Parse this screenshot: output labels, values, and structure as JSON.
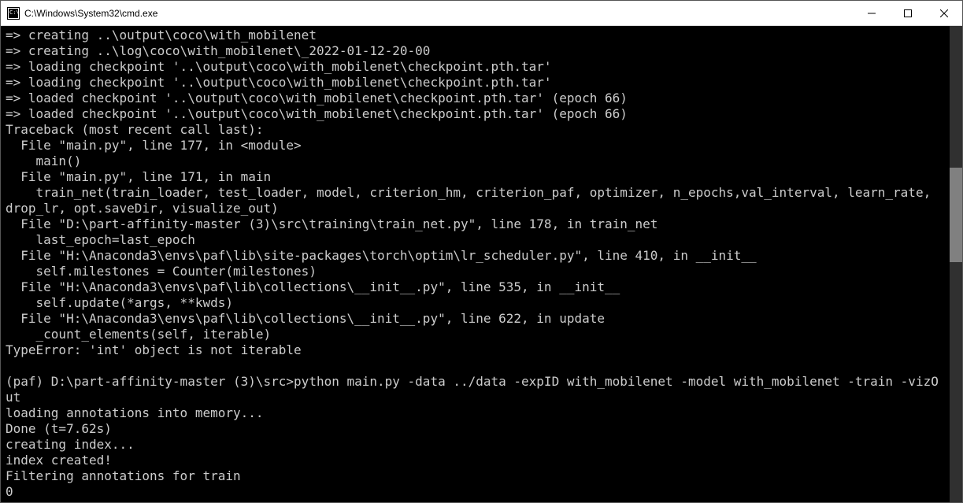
{
  "window": {
    "title": "C:\\Windows\\System32\\cmd.exe"
  },
  "terminal": {
    "lines": [
      "=> creating ..\\output\\coco\\with_mobilenet",
      "=> creating ..\\log\\coco\\with_mobilenet\\_2022-01-12-20-00",
      "=> loading checkpoint '..\\output\\coco\\with_mobilenet\\checkpoint.pth.tar'",
      "=> loading checkpoint '..\\output\\coco\\with_mobilenet\\checkpoint.pth.tar'",
      "=> loaded checkpoint '..\\output\\coco\\with_mobilenet\\checkpoint.pth.tar' (epoch 66)",
      "=> loaded checkpoint '..\\output\\coco\\with_mobilenet\\checkpoint.pth.tar' (epoch 66)",
      "Traceback (most recent call last):",
      "  File \"main.py\", line 177, in <module>",
      "    main()",
      "  File \"main.py\", line 171, in main",
      "    train_net(train_loader, test_loader, model, criterion_hm, criterion_paf, optimizer, n_epochs,val_interval, learn_rate, drop_lr, opt.saveDir, visualize_out)",
      "  File \"D:\\part-affinity-master (3)\\src\\training\\train_net.py\", line 178, in train_net",
      "    last_epoch=last_epoch",
      "  File \"H:\\Anaconda3\\envs\\paf\\lib\\site-packages\\torch\\optim\\lr_scheduler.py\", line 410, in __init__",
      "    self.milestones = Counter(milestones)",
      "  File \"H:\\Anaconda3\\envs\\paf\\lib\\collections\\__init__.py\", line 535, in __init__",
      "    self.update(*args, **kwds)",
      "  File \"H:\\Anaconda3\\envs\\paf\\lib\\collections\\__init__.py\", line 622, in update",
      "    _count_elements(self, iterable)",
      "TypeError: 'int' object is not iterable",
      "",
      "(paf) D:\\part-affinity-master (3)\\src>python main.py -data ../data -expID with_mobilenet -model with_mobilenet -train -vizOut",
      "loading annotations into memory...",
      "Done (t=7.62s)",
      "creating index...",
      "index created!",
      "Filtering annotations for train",
      "0"
    ]
  }
}
